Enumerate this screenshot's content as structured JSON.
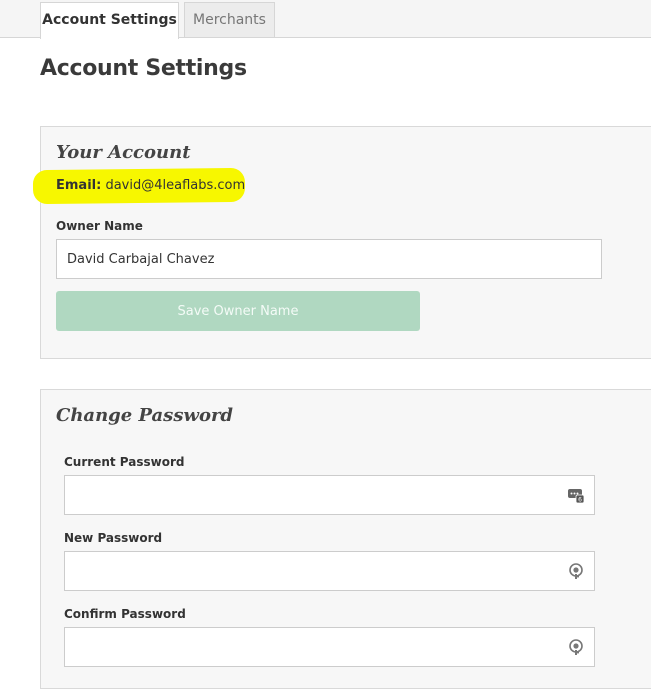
{
  "tabs": [
    {
      "label": "Account Settings",
      "active": true
    },
    {
      "label": "Merchants",
      "active": false
    }
  ],
  "page_title": "Account Settings",
  "account": {
    "section_title": "Your Account",
    "email_label": "Email:",
    "email_value": "david@4leaflabs.com",
    "owner_name_label": "Owner Name",
    "owner_name_value": "David Carbajal Chavez",
    "save_button_label": "Save Owner Name"
  },
  "password": {
    "section_title": "Change Password",
    "current_label": "Current Password",
    "new_label": "New Password",
    "confirm_label": "Confirm Password",
    "current_icon": "password-manager-icon",
    "new_icon": "key-icon",
    "confirm_icon": "key-icon"
  },
  "colors": {
    "highlight": "#f7f700",
    "save_button": "#b0d8c1",
    "panel_bg": "#f7f7f7"
  }
}
